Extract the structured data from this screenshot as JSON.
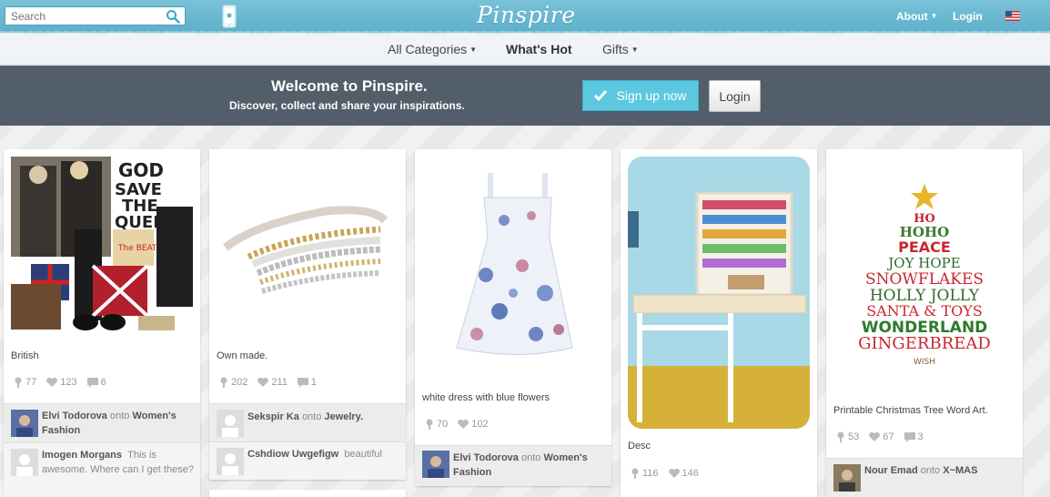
{
  "header": {
    "search_placeholder": "Search",
    "logo": "Pinspire",
    "about": "About",
    "login": "Login"
  },
  "nav": {
    "all_categories": "All Categories",
    "whats_hot": "What's Hot",
    "gifts": "Gifts"
  },
  "banner": {
    "title": "Welcome to Pinspire.",
    "subtitle": "Discover, collect and share your inspirations.",
    "signup": "Sign up now",
    "login": "Login"
  },
  "pins": [
    {
      "desc": "British",
      "repins": "77",
      "likes": "123",
      "comments": "6",
      "user": "Elvi Todorova",
      "onto": "onto",
      "board": "Women's Fashion",
      "commenter": "Imogen Morgans",
      "comment": "This is awesome. Where can I get these?"
    },
    {
      "desc": "Own made.",
      "repins": "202",
      "likes": "211",
      "comments": "1",
      "user": "Sekspir Ka",
      "onto": "onto",
      "board": "Jewelry.",
      "commenter": "Cshdiow Uwgefigw",
      "comment": "beautiful"
    },
    {
      "desc": "white dress with blue flowers",
      "repins": "70",
      "likes": "102",
      "user": "Elvi Todorova",
      "onto": "onto",
      "board": "Women's Fashion"
    },
    {
      "desc": "Desc",
      "repins": "116",
      "likes": "146"
    },
    {
      "desc": "Printable Christmas Tree Word Art.",
      "repins": "53",
      "likes": "67",
      "comments": "3",
      "user": "Nour Emad",
      "onto": "onto",
      "board": "X~MAS",
      "tree_words": [
        "HO",
        "HOHO",
        "PEACE",
        "JOY HOPE",
        "SNOWFLAKES",
        "HOLLY JOLLY",
        "SANTA & TOYS",
        "WONDERLAND",
        "GINGERBREAD",
        "WISH"
      ]
    }
  ],
  "colors": {
    "header": "#6bb9d1",
    "banner": "#525e69",
    "signup": "#5cc8e0"
  }
}
